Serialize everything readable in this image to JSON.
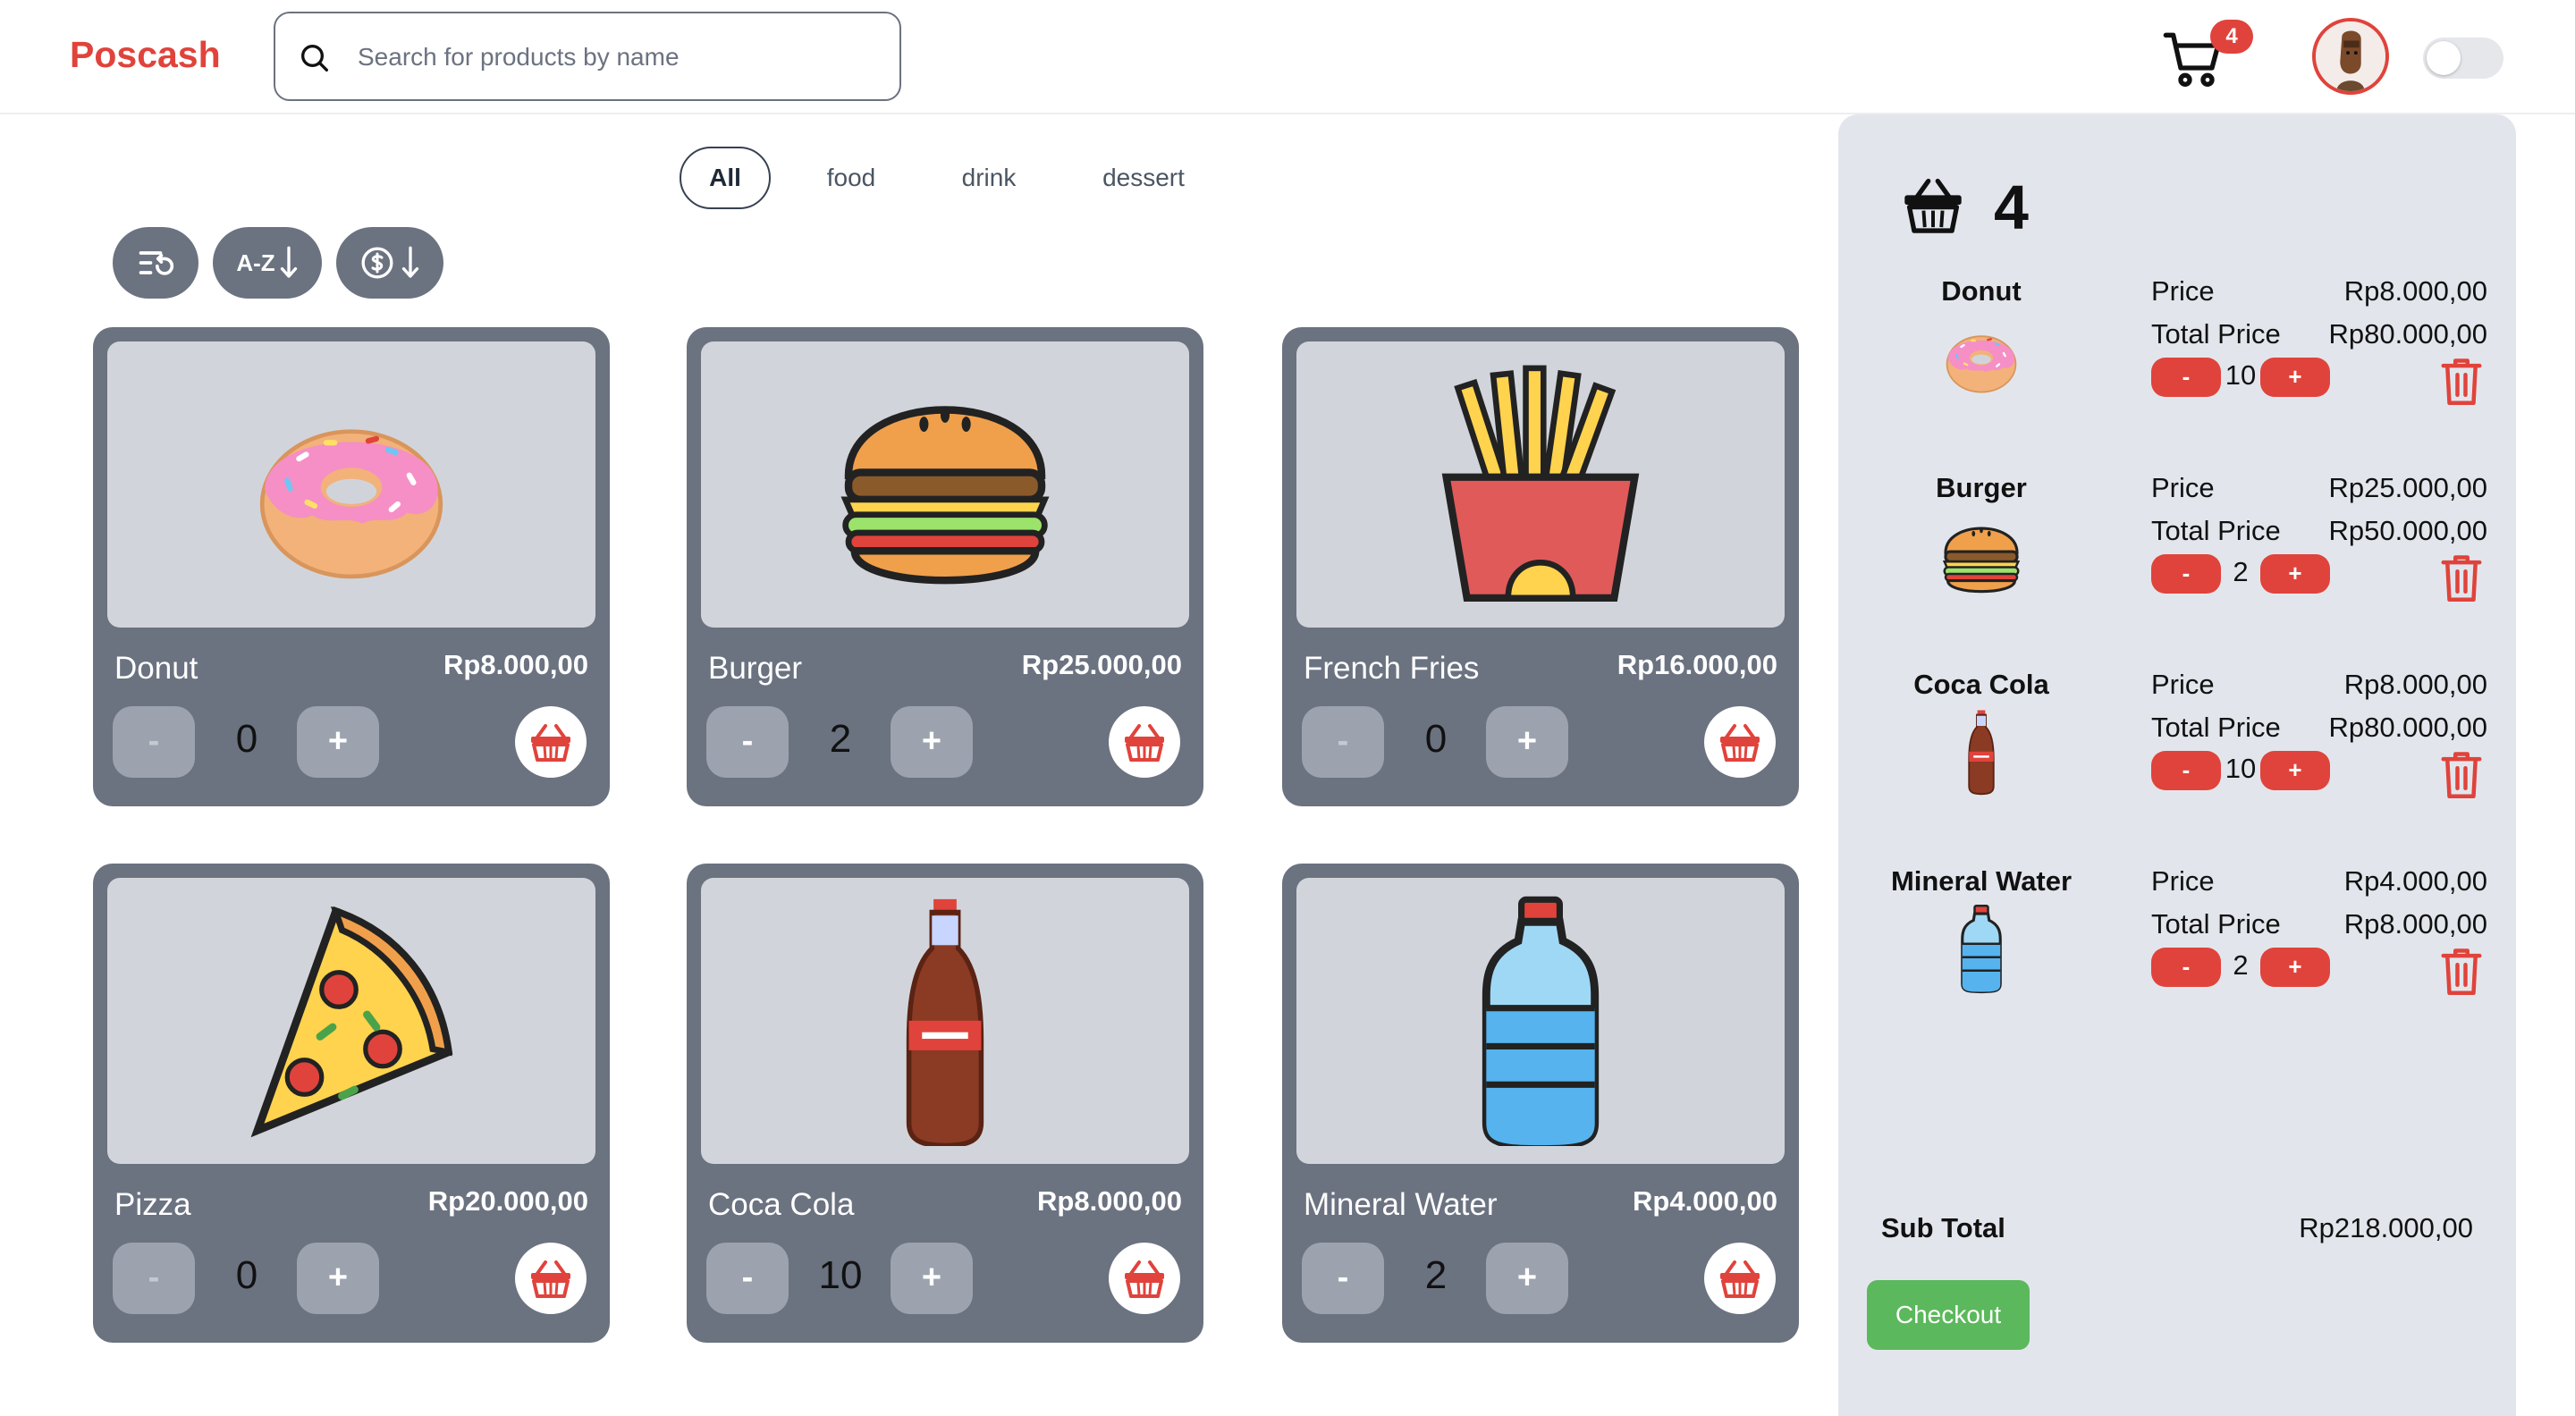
{
  "header": {
    "brand": "Poscash",
    "search_placeholder": "Search for products by name",
    "cart_badge": "4"
  },
  "tabs": [
    {
      "label": "All",
      "active": true
    },
    {
      "label": "food"
    },
    {
      "label": "drink"
    },
    {
      "label": "dessert"
    }
  ],
  "sort": {
    "alpha_label": "A-Z"
  },
  "products": [
    {
      "name": "Donut",
      "price": "Rp8.000,00",
      "qty": "0",
      "minus": "-",
      "plus": "+",
      "icon": "donut-icon"
    },
    {
      "name": "Burger",
      "price": "Rp25.000,00",
      "qty": "2",
      "minus": "-",
      "plus": "+",
      "icon": "burger-icon"
    },
    {
      "name": "French Fries",
      "price": "Rp16.000,00",
      "qty": "0",
      "minus": "-",
      "plus": "+",
      "icon": "fries-icon"
    },
    {
      "name": "Pizza",
      "price": "Rp20.000,00",
      "qty": "0",
      "minus": "-",
      "plus": "+",
      "icon": "pizza-icon"
    },
    {
      "name": "Coca Cola",
      "price": "Rp8.000,00",
      "qty": "10",
      "minus": "-",
      "plus": "+",
      "icon": "cola-icon"
    },
    {
      "name": "Mineral Water",
      "price": "Rp4.000,00",
      "qty": "2",
      "minus": "-",
      "plus": "+",
      "icon": "water-bottle-icon"
    }
  ],
  "cart": {
    "count": "4",
    "price_label": "Price",
    "total_label": "Total Price",
    "items": [
      {
        "name": "Donut",
        "price": "Rp8.000,00",
        "total": "Rp80.000,00",
        "qty": "10",
        "minus": "-",
        "plus": "+"
      },
      {
        "name": "Burger",
        "price": "Rp25.000,00",
        "total": "Rp50.000,00",
        "qty": "2",
        "minus": "-",
        "plus": "+"
      },
      {
        "name": "Coca Cola",
        "price": "Rp8.000,00",
        "total": "Rp80.000,00",
        "qty": "10",
        "minus": "-",
        "plus": "+"
      },
      {
        "name": "Mineral Water",
        "price": "Rp4.000,00",
        "total": "Rp8.000,00",
        "qty": "2",
        "minus": "-",
        "plus": "+"
      }
    ],
    "subtotal_label": "Sub Total",
    "subtotal": "Rp218.000,00",
    "checkout_label": "Checkout"
  },
  "colors": {
    "brand": "#e0433b",
    "card": "#6b7280",
    "panel": "#e2e6ec",
    "checkout": "#5cb85c"
  }
}
